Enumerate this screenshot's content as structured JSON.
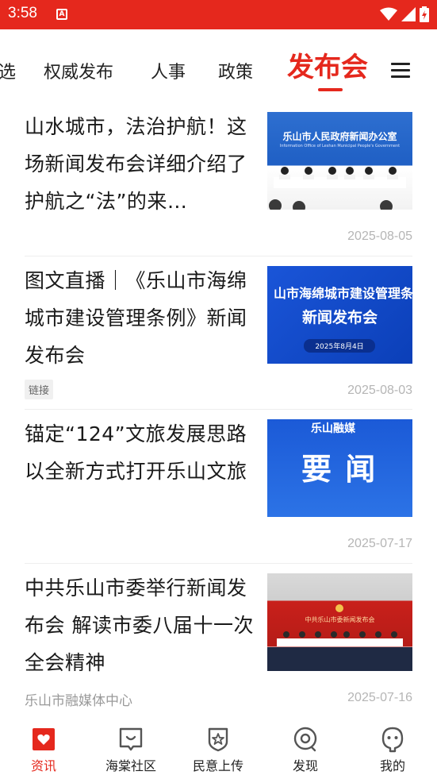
{
  "status_bar": {
    "time": "3:58",
    "app_icon_letter": "A",
    "colors": {
      "background": "#e5281d"
    }
  },
  "tabs": {
    "items": [
      "选",
      "权威发布",
      "人事",
      "政策",
      "发布会"
    ],
    "active_index": 4,
    "menu_icon": "hamburger-menu-icon",
    "colors": {
      "active": "#e5281d",
      "inactive": "#222222"
    }
  },
  "feed": [
    {
      "title": "山水城市，法治护航！这场新闻发布会详细介绍了护航之“法”的来…",
      "date": "2025-08-05",
      "thumb_caption": "乐山市人民政府新闻办公室",
      "thumb_subcaption": "Information Office of Leshan Municipal People's Government"
    },
    {
      "title": "图文直播｜《乐山市海绵城市建设管理条例》新闻发布会",
      "tag": "链接",
      "date": "2025-08-03",
      "thumb_line1": "山市海绵城市建设管理条",
      "thumb_line2": "新闻发布会",
      "thumb_line3": "2025年8月4日"
    },
    {
      "title": "锚定“124”文旅发展思路 以全新方式打开乐山文旅",
      "date": "2025-07-17",
      "thumb_logo": "乐山融媒",
      "thumb_headline": "要 闻"
    },
    {
      "title": "中共乐山市委举行新闻发布会 解读市委八届十一次全会精神",
      "source": "乐山市融媒体中心",
      "date": "2025-07-16",
      "thumb_banner": "中共乐山市委新闻发布会"
    }
  ],
  "bottom_nav": {
    "items": [
      {
        "label": "资讯",
        "icon": "news-heart-icon",
        "active": true
      },
      {
        "label": "海棠社区",
        "icon": "community-chat-icon",
        "active": false
      },
      {
        "label": "民意上传",
        "icon": "star-shield-icon",
        "active": false
      },
      {
        "label": "发现",
        "icon": "discover-icon",
        "active": false
      },
      {
        "label": "我的",
        "icon": "profile-face-icon",
        "active": false
      }
    ],
    "colors": {
      "active": "#e5281d",
      "inactive": "#222222"
    }
  }
}
